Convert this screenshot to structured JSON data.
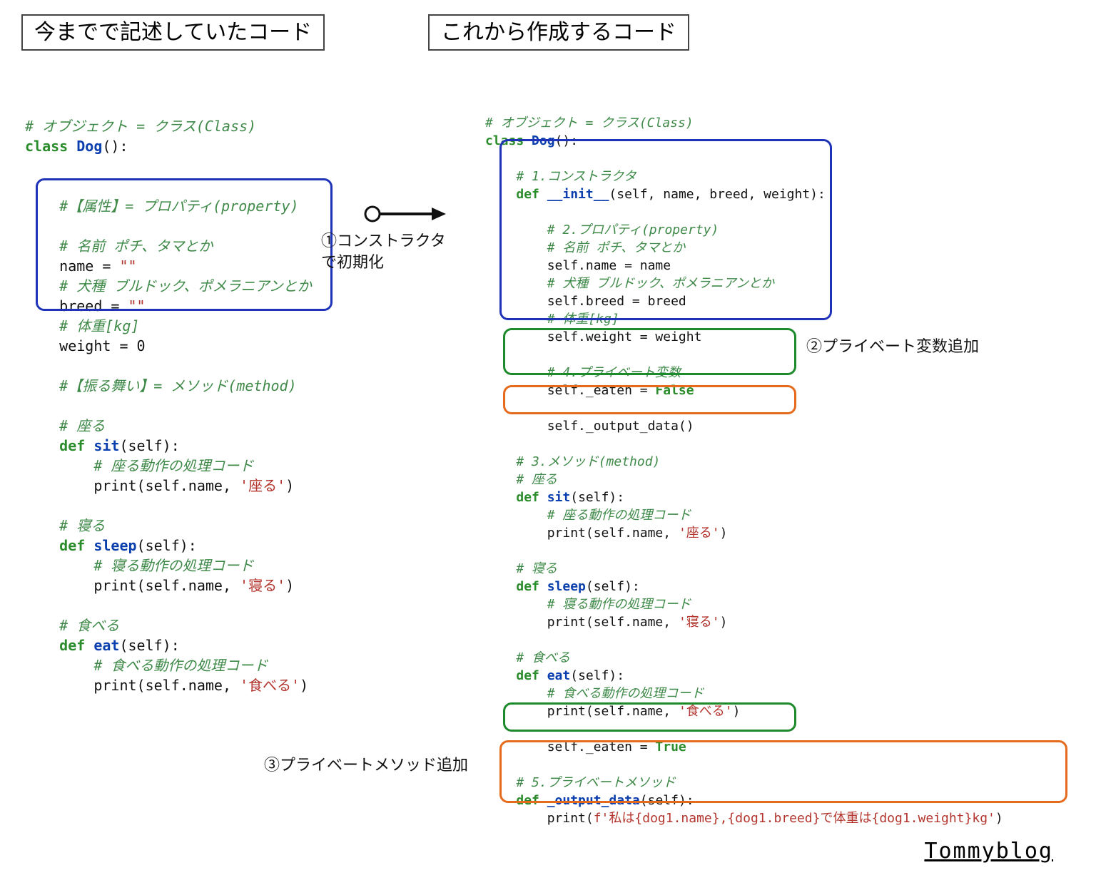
{
  "titles": {
    "left": "今までで記述していたコード",
    "right": "これから作成するコード"
  },
  "annotations": {
    "arrow1_line1": "①コンストラクタ",
    "arrow1_line2": "で初期化",
    "arrow2": "②プライベート変数追加",
    "arrow3": "③プライベートメソッド追加"
  },
  "credit": "Tommyblog",
  "left_code": {
    "l01": "# オブジェクト = クラス(Class)",
    "l02a": "class",
    "l02b": " Dog",
    "l02c": "():",
    "l03": "    #【属性】= プロパティ(property)",
    "l04": "    # 名前 ポチ、タマとか",
    "l05a": "    name = ",
    "l05b": "\"\"",
    "l06": "    # 犬種 ブルドック、ポメラニアンとか",
    "l07a": "    breed = ",
    "l07b": "\"\"",
    "l08": "    # 体重[kg]",
    "l09": "    weight = 0",
    "l10": "    #【振る舞い】= メソッド(method)",
    "l11": "    # 座る",
    "l12a": "    ",
    "l12b": "def",
    "l12c": " sit",
    "l12d": "(self):",
    "l13": "        # 座る動作の処理コード",
    "l14a": "        print(self.name, ",
    "l14b": "'座る'",
    "l14c": ")",
    "l15": "    # 寝る",
    "l16a": "    ",
    "l16b": "def",
    "l16c": " sleep",
    "l16d": "(self):",
    "l17": "        # 寝る動作の処理コード",
    "l18a": "        print(self.name, ",
    "l18b": "'寝る'",
    "l18c": ")",
    "l19": "    # 食べる",
    "l20a": "    ",
    "l20b": "def",
    "l20c": " eat",
    "l20d": "(self):",
    "l21": "        # 食べる動作の処理コード",
    "l22a": "        print(self.name, ",
    "l22b": "'食べる'",
    "l22c": ")"
  },
  "right_code": {
    "r01": "# オブジェクト = クラス(Class)",
    "r02a": "class",
    "r02b": " Dog",
    "r02c": "():",
    "r03": "    # 1.コンストラクタ",
    "r04a": "    ",
    "r04b": "def",
    "r04c": " __init__",
    "r04d": "(self, name, breed, weight):",
    "r05": "        # 2.プロパティ(property)",
    "r06": "        # 名前 ポチ、タマとか",
    "r07": "        self.name = name",
    "r08": "        # 犬種 ブルドック、ポメラニアンとか",
    "r09": "        self.breed = breed",
    "r10": "        # 体重[kg]",
    "r11": "        self.weight = weight",
    "r12": "        # 4.プライベート変数",
    "r13a": "        self._eaten = ",
    "r13b": "False",
    "r14": "        self._output_data()",
    "r15": "    # 3.メソッド(method)",
    "r16": "    # 座る",
    "r17a": "    ",
    "r17b": "def",
    "r17c": " sit",
    "r17d": "(self):",
    "r18": "        # 座る動作の処理コード",
    "r19a": "        print(self.name, ",
    "r19b": "'座る'",
    "r19c": ")",
    "r20": "    # 寝る",
    "r21a": "    ",
    "r21b": "def",
    "r21c": " sleep",
    "r21d": "(self):",
    "r22": "        # 寝る動作の処理コード",
    "r23a": "        print(self.name, ",
    "r23b": "'寝る'",
    "r23c": ")",
    "r24": "    # 食べる",
    "r25a": "    ",
    "r25b": "def",
    "r25c": " eat",
    "r25d": "(self):",
    "r26": "        # 食べる動作の処理コード",
    "r27a": "        print(self.name, ",
    "r27b": "'食べる'",
    "r27c": ")",
    "r28a": "        self._eaten = ",
    "r28b": "True",
    "r29": "    # 5.プライベートメソッド",
    "r30a": "    ",
    "r30b": "def",
    "r30c": " _output_data",
    "r30d": "(self):",
    "r31a": "        print(",
    "r31b": "f'私は{dog1.name},{dog1.breed}で体重は{dog1.weight}kg'",
    "r31c": ")"
  }
}
